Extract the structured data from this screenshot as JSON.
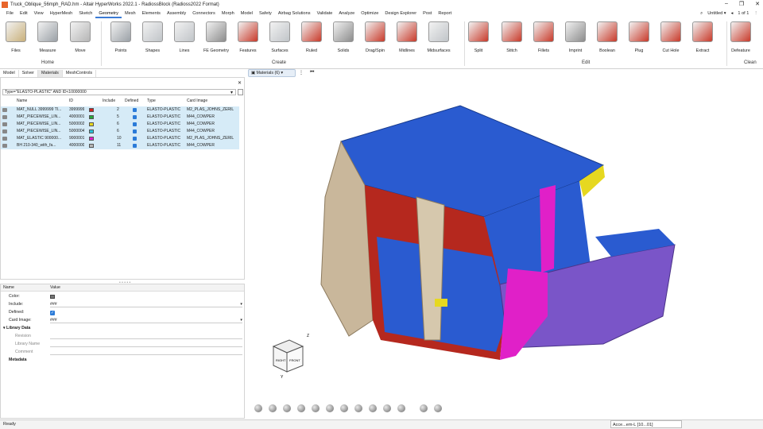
{
  "window": {
    "title": "Truck_Oblique_56mph_RAD.hm - Altair HyperWorks 2022.1 - RadiossBlock (Radioss2022 Format)",
    "controls": [
      "–",
      "❐",
      "✕"
    ]
  },
  "menubar": {
    "items": [
      "File",
      "Edit",
      "View",
      "HyperMesh",
      "Sketch",
      "Geometry",
      "Mesh",
      "Elements",
      "Assembly",
      "Connectors",
      "Morph",
      "Model",
      "Safety",
      "Airbag Solutions",
      "Validate",
      "Analyze",
      "Optimize",
      "Design Explorer",
      "Post",
      "Report"
    ],
    "active": "Geometry",
    "session": "Untitled",
    "pages": "1 of 1"
  },
  "ribbon": {
    "groups": [
      {
        "label": "Home",
        "tools": [
          "Files",
          "Measure",
          "Move"
        ]
      },
      {
        "label": "Create",
        "tools": [
          "Points",
          "Shapes",
          "Lines",
          "FE Geometry",
          "Features",
          "Surfaces",
          "Ruled",
          "Solids",
          "Drag/Spin",
          "Midlines",
          "Midsurfaces"
        ]
      },
      {
        "label": "Edit",
        "tools": [
          "Split",
          "Stitch",
          "Fillets",
          "Imprint",
          "Boolean",
          "Plug",
          "Cut Hole",
          "Extract"
        ]
      },
      {
        "label": "Clean",
        "tools": [
          "Defeature"
        ]
      }
    ],
    "colors": {
      "accent": "#c83a2a",
      "gray": "#8c8c8c"
    }
  },
  "panel": {
    "tabs": [
      "Model",
      "Solver",
      "Materials",
      "MeshControls"
    ],
    "active_tab": "Materials",
    "filter": "Type=\"ELASTO-PLASTIC\" AND ID<10000000",
    "columns": [
      "Name",
      "ID",
      "Include",
      "Defined",
      "Type",
      "Card Image"
    ],
    "rows": [
      {
        "name": "MAT_NULL 3999999 TI...",
        "id": "3999999",
        "color": "#d42020",
        "include": "2",
        "type": "ELASTO-PLASTIC",
        "card": "M2_PLAS_JOHNS_ZERIL"
      },
      {
        "name": "MAT_PIECEWISE_LIN...",
        "id": "4000001",
        "color": "#28a83a",
        "include": "5",
        "type": "ELASTO-PLASTIC",
        "card": "M44_COWPER"
      },
      {
        "name": "MAT_PIECEWISE_LIN...",
        "id": "5000002",
        "color": "#e6d820",
        "include": "6",
        "type": "ELASTO-PLASTIC",
        "card": "M44_COWPER"
      },
      {
        "name": "MAT_PIECEWISE_LIN...",
        "id": "5000004",
        "color": "#26c2d8",
        "include": "6",
        "type": "ELASTO-PLASTIC",
        "card": "M44_COWPER"
      },
      {
        "name": "MAT_ELASTIC 900000...",
        "id": "9000001",
        "color": "#e020c8",
        "include": "10",
        "type": "ELASTO-PLASTIC",
        "card": "M2_PLAS_JOHNS_ZERIL"
      },
      {
        "name": "BH 210-340_with_fa...",
        "id": "4000000",
        "color": "#b8b8b8",
        "include": "11",
        "type": "ELASTO-PLASTIC",
        "card": "M44_COWPER"
      }
    ]
  },
  "properties": {
    "headers": [
      "Name",
      "Value"
    ],
    "fields": [
      {
        "key": "Color:",
        "value": ""
      },
      {
        "key": "Include:",
        "value": "###"
      },
      {
        "key": "Defined:",
        "value": ""
      },
      {
        "key": "Card Image:",
        "value": "###"
      }
    ],
    "library_section": "Library Data",
    "library_fields": [
      "Revision",
      "Library Name",
      "Comment"
    ],
    "metadata_section": "Metadata"
  },
  "viewport": {
    "filter_label": "Materials (6)",
    "view_cube": {
      "right": "RIGHT",
      "front": "FRONT",
      "axis_z": "Z",
      "axis_y": "Y"
    }
  },
  "status": {
    "text": "Ready",
    "right_text": "Acce...em-L [10...01]"
  }
}
